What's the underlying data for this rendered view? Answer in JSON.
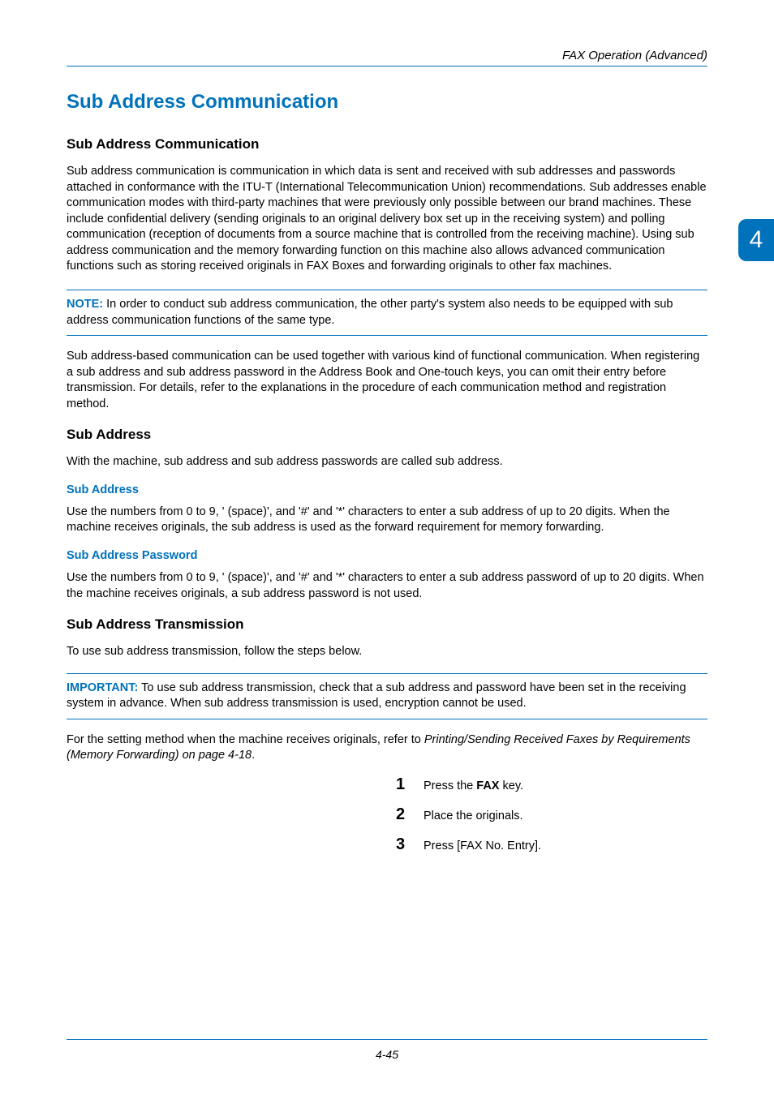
{
  "header": {
    "title": "FAX Operation (Advanced)"
  },
  "sideTab": "4",
  "h1": "Sub Address Communication",
  "sec1": {
    "heading": "Sub Address Communication",
    "p1": "Sub address communication is communication in which data is sent and received with sub addresses and passwords attached in conformance with the ITU-T (International Telecommunication Union) recommendations. Sub addresses enable communication modes with third-party machines that were previously only possible between our brand machines. These include confidential delivery (sending originals to an original delivery box set up in the receiving system) and polling communication (reception of documents from a source machine that is controlled from the receiving machine). Using sub address communication and the memory forwarding function on this machine also allows advanced communication functions such as storing received originals in FAX Boxes and forwarding originals to other fax machines."
  },
  "note": {
    "label": "NOTE:",
    "text": " In order to conduct sub address communication, the other party's system also needs to be equipped with sub address communication functions of the same type."
  },
  "sec1b": {
    "p2": "Sub address-based communication can be used together with various kind of functional communication. When registering a sub address and sub address password in the Address Book and One-touch keys, you can omit their entry before transmission. For details, refer to the explanations in the procedure of each communication method and registration method."
  },
  "sec2": {
    "heading": "Sub Address",
    "p1": "With the machine, sub address and sub address passwords are called sub address.",
    "sub1": "Sub Address",
    "p2": "Use the numbers from 0 to 9, ' (space)', and '#' and '*' characters to enter a sub address of up to 20 digits. When the machine receives originals, the sub address is used as the forward requirement for memory forwarding.",
    "sub2": "Sub Address Password",
    "p3": "Use the numbers from 0 to 9, ' (space)', and '#' and '*' characters to enter a sub address password of up to 20 digits. When the machine receives originals, a sub address password is not used."
  },
  "sec3": {
    "heading": "Sub Address Transmission",
    "p1": "To use sub address transmission, follow the steps below."
  },
  "important": {
    "label": "IMPORTANT:",
    "text": " To use sub address transmission, check that a sub address and password have been set in the receiving system in advance. When sub address transmission is used, encryption cannot be used."
  },
  "afterImportant": {
    "lead": "For the setting method when the machine receives originals, refer to ",
    "italic": "Printing/Sending Received Faxes by Requirements (Memory Forwarding) on page 4-18",
    "tail": "."
  },
  "steps": [
    {
      "n": "1",
      "pre": "Press the ",
      "bold": "FAX",
      "post": " key."
    },
    {
      "n": "2",
      "pre": "Place the originals.",
      "bold": "",
      "post": ""
    },
    {
      "n": "3",
      "pre": "Press [FAX No. Entry].",
      "bold": "",
      "post": ""
    }
  ],
  "footer": {
    "pagenum": "4-45"
  }
}
